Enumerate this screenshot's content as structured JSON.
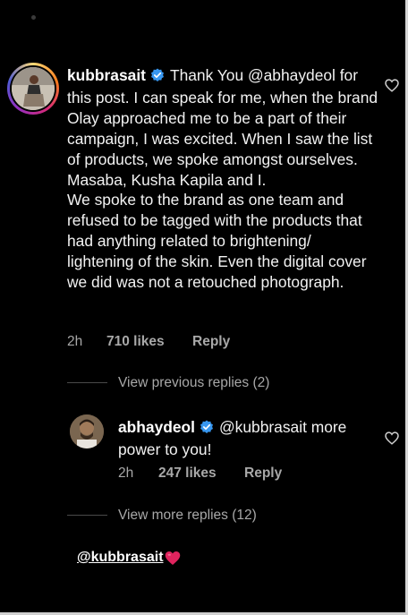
{
  "comment": {
    "username": "kubbrasait",
    "text": "Thank You @abhaydeol for this post. I can speak for me, when the brand Olay approached me to be a part of their campaign, I was excited. When I saw the list of products, we spoke amongst ourselves. Masaba, Kusha Kapila and I.\nWe spoke to the brand as one team and refused to be tagged with the products that had anything related to brightening/ lightening of the skin. Even the digital cover we did was not a retouched photograph.",
    "time": "2h",
    "likes": "710 likes",
    "reply_label": "Reply"
  },
  "view_previous": "View previous replies (2)",
  "reply": {
    "username": "abhaydeol",
    "text": "@kubbrasait more power to you!",
    "time": "2h",
    "likes": "247 likes",
    "reply_label": "Reply"
  },
  "view_more": "View more replies (12)",
  "caption": {
    "mention": "@kubbrasait",
    "emoji": "red-heart"
  },
  "colors": {
    "background": "#000000",
    "verified": "#3897f0",
    "muted": "#a8a8a8",
    "heart": "#e0245e"
  },
  "icons": [
    "verified-badge-icon",
    "heart-outline-icon",
    "red-heart-emoji"
  ]
}
